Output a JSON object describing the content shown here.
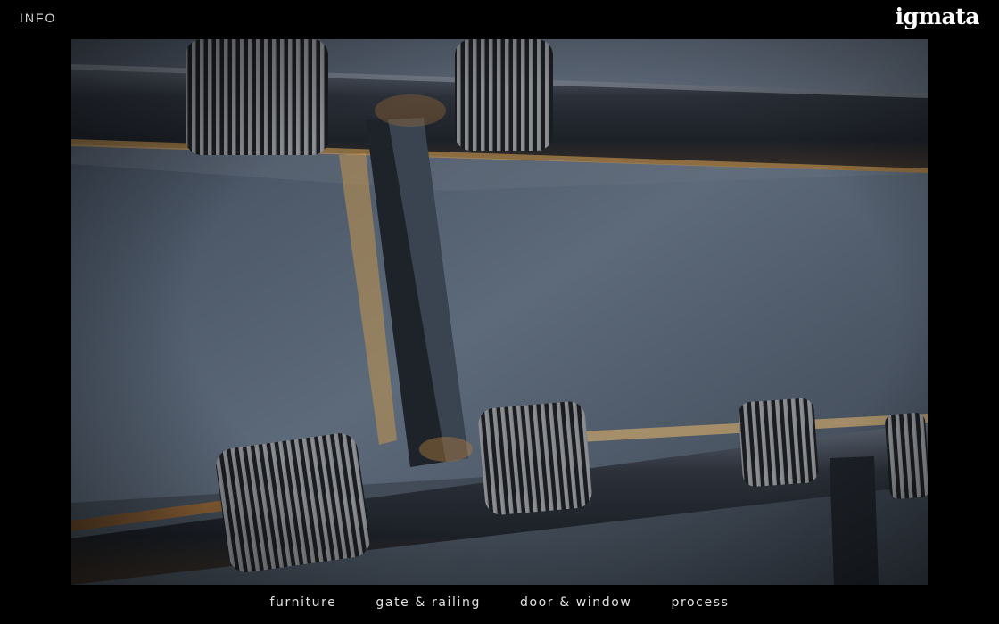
{
  "header": {
    "info_label": "INFO",
    "logo_text": "igmata"
  },
  "hero": {
    "icon": "photo-rusted-iron-chain-with-coil-wraps"
  },
  "nav": {
    "items": [
      {
        "label": "furniture"
      },
      {
        "label": "gate & railing"
      },
      {
        "label": "door & window"
      },
      {
        "label": "process"
      }
    ]
  },
  "colors": {
    "background": "#000000",
    "text": "#e2e2e2",
    "steel": "#4a5666",
    "rust": "#8a5a2a"
  }
}
